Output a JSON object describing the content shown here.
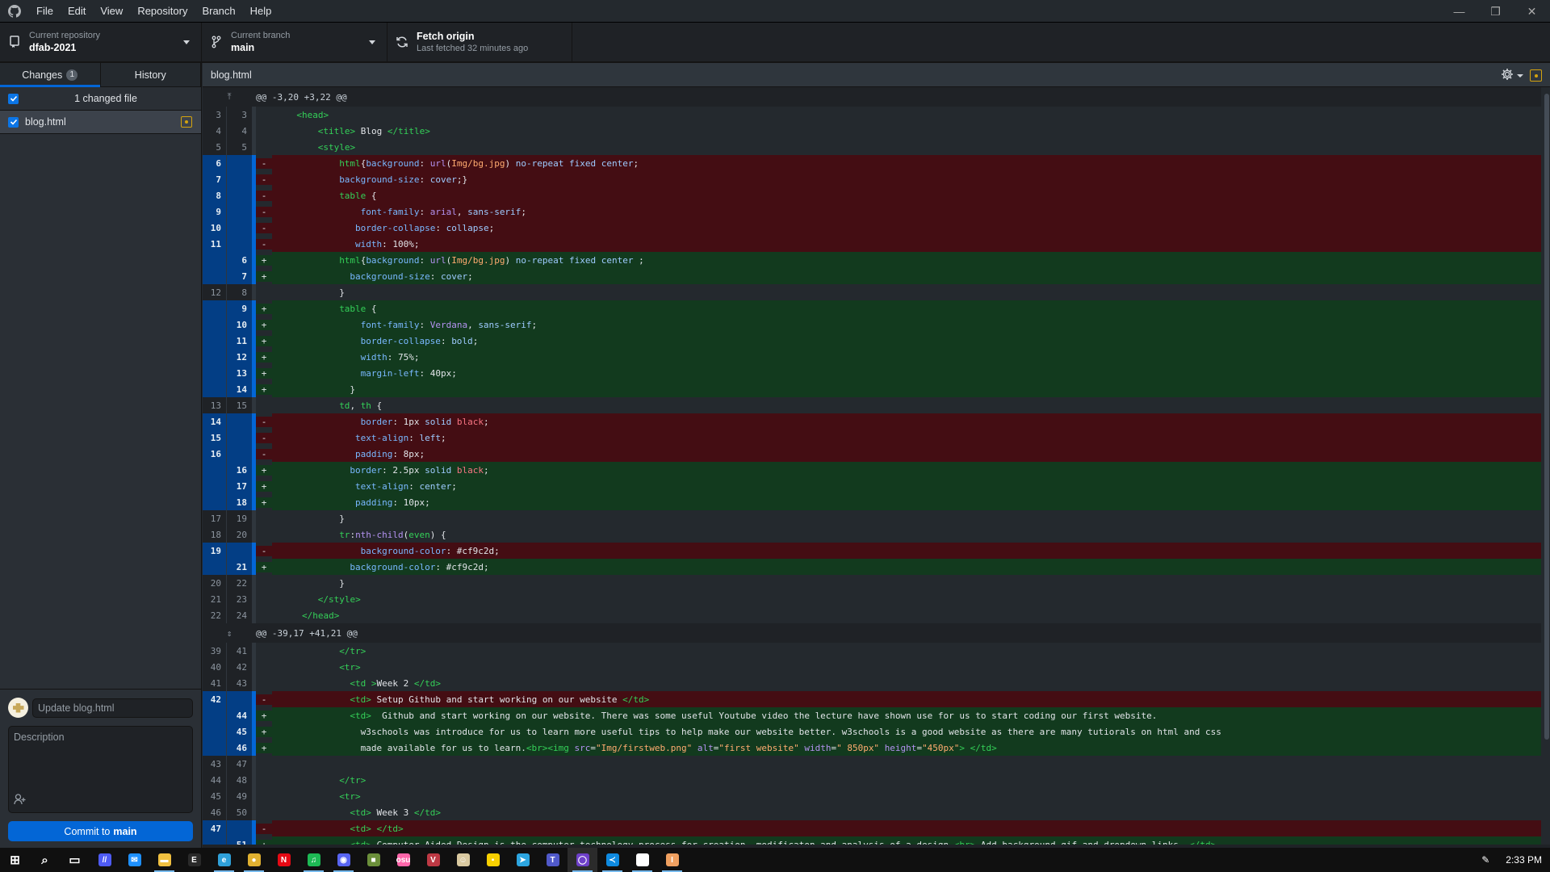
{
  "app": {
    "menu": [
      "File",
      "Edit",
      "View",
      "Repository",
      "Branch",
      "Help"
    ],
    "window_controls": [
      "minimize",
      "restore",
      "close"
    ]
  },
  "toolbar": {
    "repository": {
      "label": "Current repository",
      "value": "dfab-2021"
    },
    "branch": {
      "label": "Current branch",
      "value": "main"
    },
    "fetch": {
      "label": "Fetch origin",
      "value": "Last fetched 32 minutes ago"
    }
  },
  "sidebar": {
    "tabs": [
      {
        "label": "Changes",
        "badge": "1",
        "active": true
      },
      {
        "label": "History",
        "active": false
      }
    ],
    "changed_header": "1 changed file",
    "files": [
      {
        "name": "blog.html",
        "checked": true,
        "status": "modified"
      }
    ],
    "commit": {
      "summary_placeholder": "Update blog.html",
      "description_placeholder": "Description",
      "button_prefix": "Commit to",
      "button_branch": "main"
    }
  },
  "diff": {
    "file_name": "blog.html",
    "rows": [
      {
        "type": "hunk",
        "text": "@@ -3,20 +3,22 @@",
        "expand": "up"
      },
      {
        "type": "ctx",
        "old": "3",
        "new": "3",
        "indent": 4,
        "tokens": [
          [
            "tag",
            "<head>"
          ]
        ]
      },
      {
        "type": "ctx",
        "old": "4",
        "new": "4",
        "indent": 8,
        "tokens": [
          [
            "tag",
            "<title>"
          ],
          [
            "txt",
            " Blog "
          ],
          [
            "tag",
            "</title>"
          ]
        ]
      },
      {
        "type": "ctx",
        "old": "5",
        "new": "5",
        "indent": 8,
        "tokens": [
          [
            "tag",
            "<style>"
          ]
        ]
      },
      {
        "type": "del",
        "old": "6",
        "new": "",
        "indent": 12,
        "tokens": [
          [
            "sel",
            "html"
          ],
          [
            "txt",
            "{"
          ],
          [
            "prop",
            "background"
          ],
          [
            "txt",
            ": "
          ],
          [
            "fn",
            "url"
          ],
          [
            "txt",
            "("
          ],
          [
            "str",
            "Img/bg.jpg"
          ],
          [
            "txt",
            ") "
          ],
          [
            "val",
            "no-repeat fixed center"
          ],
          [
            "txt",
            ";"
          ]
        ]
      },
      {
        "type": "del",
        "old": "7",
        "new": "",
        "indent": 12,
        "tokens": [
          [
            "prop",
            "background-size"
          ],
          [
            "txt",
            ": "
          ],
          [
            "val",
            "cover"
          ],
          [
            "txt",
            ";}"
          ]
        ]
      },
      {
        "type": "del",
        "old": "8",
        "new": "",
        "indent": 12,
        "tokens": [
          [
            "sel",
            "table"
          ],
          [
            "txt",
            " {"
          ]
        ]
      },
      {
        "type": "del",
        "old": "9",
        "new": "",
        "indent": 16,
        "tokens": [
          [
            "prop",
            "font-family"
          ],
          [
            "txt",
            ": "
          ],
          [
            "fn",
            "arial"
          ],
          [
            "txt",
            ", "
          ],
          [
            "val",
            "sans-serif"
          ],
          [
            "txt",
            ";"
          ]
        ]
      },
      {
        "type": "del",
        "old": "10",
        "new": "",
        "indent": 15,
        "tokens": [
          [
            "prop",
            "border-collapse"
          ],
          [
            "txt",
            ": "
          ],
          [
            "val",
            "collapse"
          ],
          [
            "txt",
            ";"
          ]
        ]
      },
      {
        "type": "del",
        "old": "11",
        "new": "",
        "indent": 15,
        "tokens": [
          [
            "prop",
            "width"
          ],
          [
            "txt",
            ": 100%;"
          ]
        ]
      },
      {
        "type": "add",
        "old": "",
        "new": "6",
        "indent": 12,
        "tokens": [
          [
            "sel",
            "html"
          ],
          [
            "txt",
            "{"
          ],
          [
            "prop",
            "background"
          ],
          [
            "txt",
            ": "
          ],
          [
            "fn",
            "url"
          ],
          [
            "txt",
            "("
          ],
          [
            "str",
            "Img/bg.jpg"
          ],
          [
            "txt",
            ") "
          ],
          [
            "val",
            "no-repeat fixed center"
          ],
          [
            "txt",
            " ;"
          ]
        ]
      },
      {
        "type": "add",
        "old": "",
        "new": "7",
        "indent": 14,
        "tokens": [
          [
            "prop",
            "background-size"
          ],
          [
            "txt",
            ": "
          ],
          [
            "val",
            "cover"
          ],
          [
            "txt",
            ";"
          ]
        ]
      },
      {
        "type": "ctx",
        "old": "12",
        "new": "8",
        "indent": 12,
        "tokens": [
          [
            "txt",
            "}"
          ]
        ]
      },
      {
        "type": "add",
        "old": "",
        "new": "9",
        "indent": 12,
        "tokens": [
          [
            "sel",
            "table"
          ],
          [
            "txt",
            " {"
          ]
        ]
      },
      {
        "type": "add",
        "old": "",
        "new": "10",
        "indent": 16,
        "tokens": [
          [
            "prop",
            "font-family"
          ],
          [
            "txt",
            ": "
          ],
          [
            "fn",
            "Verdana"
          ],
          [
            "txt",
            ", "
          ],
          [
            "val",
            "sans-serif"
          ],
          [
            "txt",
            ";"
          ]
        ]
      },
      {
        "type": "add",
        "old": "",
        "new": "11",
        "indent": 16,
        "tokens": [
          [
            "prop",
            "border-collapse"
          ],
          [
            "txt",
            ": "
          ],
          [
            "val",
            "bold"
          ],
          [
            "txt",
            ";"
          ]
        ]
      },
      {
        "type": "add",
        "old": "",
        "new": "12",
        "indent": 16,
        "tokens": [
          [
            "prop",
            "width"
          ],
          [
            "txt",
            ": 75%;"
          ]
        ]
      },
      {
        "type": "add",
        "old": "",
        "new": "13",
        "indent": 16,
        "tokens": [
          [
            "prop",
            "margin-left"
          ],
          [
            "txt",
            ": 40px;"
          ]
        ]
      },
      {
        "type": "add",
        "old": "",
        "new": "14",
        "indent": 14,
        "tokens": [
          [
            "txt",
            "}"
          ]
        ]
      },
      {
        "type": "ctx",
        "old": "13",
        "new": "15",
        "indent": 12,
        "tokens": [
          [
            "sel",
            "td"
          ],
          [
            "txt",
            ", "
          ],
          [
            "sel",
            "th"
          ],
          [
            "txt",
            " {"
          ]
        ]
      },
      {
        "type": "del",
        "old": "14",
        "new": "",
        "indent": 16,
        "tokens": [
          [
            "prop",
            "border"
          ],
          [
            "txt",
            ": 1px "
          ],
          [
            "val",
            "solid"
          ],
          [
            "txt",
            " "
          ],
          [
            "red",
            "black"
          ],
          [
            "txt",
            ";"
          ]
        ]
      },
      {
        "type": "del",
        "old": "15",
        "new": "",
        "indent": 15,
        "tokens": [
          [
            "prop",
            "text-align"
          ],
          [
            "txt",
            ": "
          ],
          [
            "val",
            "left"
          ],
          [
            "txt",
            ";"
          ]
        ]
      },
      {
        "type": "del",
        "old": "16",
        "new": "",
        "indent": 15,
        "tokens": [
          [
            "prop",
            "padding"
          ],
          [
            "txt",
            ": 8px;"
          ]
        ]
      },
      {
        "type": "add",
        "old": "",
        "new": "16",
        "indent": 14,
        "tokens": [
          [
            "prop",
            "border"
          ],
          [
            "txt",
            ": 2.5px "
          ],
          [
            "val",
            "solid"
          ],
          [
            "txt",
            " "
          ],
          [
            "red",
            "black"
          ],
          [
            "txt",
            ";"
          ]
        ]
      },
      {
        "type": "add",
        "old": "",
        "new": "17",
        "indent": 15,
        "tokens": [
          [
            "prop",
            "text-align"
          ],
          [
            "txt",
            ": "
          ],
          [
            "val",
            "center"
          ],
          [
            "txt",
            ";"
          ]
        ]
      },
      {
        "type": "add",
        "old": "",
        "new": "18",
        "indent": 15,
        "tokens": [
          [
            "prop",
            "padding"
          ],
          [
            "txt",
            ": 10px;"
          ]
        ]
      },
      {
        "type": "ctx",
        "old": "17",
        "new": "19",
        "indent": 12,
        "tokens": [
          [
            "txt",
            "}"
          ]
        ]
      },
      {
        "type": "ctx",
        "old": "18",
        "new": "20",
        "indent": 12,
        "tokens": [
          [
            "sel",
            "tr"
          ],
          [
            "txt",
            ":"
          ],
          [
            "fn",
            "nth-child"
          ],
          [
            "txt",
            "("
          ],
          [
            "sel",
            "even"
          ],
          [
            "txt",
            ") {"
          ]
        ]
      },
      {
        "type": "del",
        "old": "19",
        "new": "",
        "indent": 16,
        "tokens": [
          [
            "prop",
            "background-color"
          ],
          [
            "txt",
            ": #cf9c2d;"
          ]
        ]
      },
      {
        "type": "add",
        "old": "",
        "new": "21",
        "indent": 14,
        "tokens": [
          [
            "prop",
            "background-color"
          ],
          [
            "txt",
            ": #cf9c2d;"
          ]
        ]
      },
      {
        "type": "ctx",
        "old": "20",
        "new": "22",
        "indent": 12,
        "tokens": [
          [
            "txt",
            "}"
          ]
        ]
      },
      {
        "type": "ctx",
        "old": "21",
        "new": "23",
        "indent": 8,
        "tokens": [
          [
            "tag",
            "</style>"
          ]
        ]
      },
      {
        "type": "ctx",
        "old": "22",
        "new": "24",
        "indent": 5,
        "tokens": [
          [
            "tag",
            "</head>"
          ]
        ]
      },
      {
        "type": "hunk",
        "text": "@@ -39,17 +41,21 @@",
        "expand": "both"
      },
      {
        "type": "ctx",
        "old": "39",
        "new": "41",
        "indent": 12,
        "tokens": [
          [
            "tag",
            "</tr>"
          ]
        ]
      },
      {
        "type": "ctx",
        "old": "40",
        "new": "42",
        "indent": 12,
        "tokens": [
          [
            "tag",
            "<tr>"
          ]
        ]
      },
      {
        "type": "ctx",
        "old": "41",
        "new": "43",
        "indent": 14,
        "tokens": [
          [
            "tag",
            "<td >"
          ],
          [
            "txt",
            "Week 2 "
          ],
          [
            "tag",
            "</td>"
          ]
        ]
      },
      {
        "type": "del",
        "old": "42",
        "new": "",
        "indent": 14,
        "tokens": [
          [
            "tag",
            "<td>"
          ],
          [
            "txt",
            " Setup Github and start working on our website "
          ],
          [
            "tag",
            "</td>"
          ]
        ]
      },
      {
        "type": "add",
        "old": "",
        "new": "44",
        "indent": 14,
        "tokens": [
          [
            "tag",
            "<td>"
          ],
          [
            "txt",
            "  Github and start working on our website. There was some useful Youtube video the lecture have shown use for us to start coding our first website."
          ]
        ]
      },
      {
        "type": "add",
        "old": "",
        "new": "45",
        "indent": 16,
        "tokens": [
          [
            "txt",
            "w3schools was introduce for us to learn more useful tips to help make our website better. w3schools is a good website as there are many tutiorals on html and css"
          ]
        ]
      },
      {
        "type": "add",
        "old": "",
        "new": "46",
        "indent": 16,
        "tokens": [
          [
            "txt",
            "made available for us to learn."
          ],
          [
            "tag",
            "<br><img "
          ],
          [
            "attr",
            "src"
          ],
          [
            "txt",
            "="
          ],
          [
            "str",
            "\"Img/firstweb.png\""
          ],
          [
            "txt",
            " "
          ],
          [
            "attr",
            "alt"
          ],
          [
            "txt",
            "="
          ],
          [
            "str",
            "\"first website\""
          ],
          [
            "txt",
            " "
          ],
          [
            "attr",
            "width"
          ],
          [
            "txt",
            "="
          ],
          [
            "str",
            "\" 850px\""
          ],
          [
            "txt",
            " "
          ],
          [
            "attr",
            "height"
          ],
          [
            "txt",
            "="
          ],
          [
            "str",
            "\"450px\""
          ],
          [
            "tag",
            ">"
          ],
          [
            "txt",
            " "
          ],
          [
            "tag",
            "</td>"
          ]
        ]
      },
      {
        "type": "ctx",
        "old": "43",
        "new": "47",
        "indent": 0,
        "tokens": []
      },
      {
        "type": "ctx",
        "old": "44",
        "new": "48",
        "indent": 12,
        "tokens": [
          [
            "tag",
            "</tr>"
          ]
        ]
      },
      {
        "type": "ctx",
        "old": "45",
        "new": "49",
        "indent": 12,
        "tokens": [
          [
            "tag",
            "<tr>"
          ]
        ]
      },
      {
        "type": "ctx",
        "old": "46",
        "new": "50",
        "indent": 14,
        "tokens": [
          [
            "tag",
            "<td>"
          ],
          [
            "txt",
            " Week 3 "
          ],
          [
            "tag",
            "</td>"
          ]
        ]
      },
      {
        "type": "del",
        "old": "47",
        "new": "",
        "indent": 14,
        "tokens": [
          [
            "tag",
            "<td>"
          ],
          [
            "txt",
            " "
          ],
          [
            "tag",
            "</td>"
          ]
        ]
      },
      {
        "type": "add",
        "old": "",
        "new": "51",
        "indent": 14,
        "tokens": [
          [
            "tag",
            "<td>"
          ],
          [
            "txt",
            " Computer Aided Design is the computer technology process for creation, modificaton and analysis of a design "
          ],
          [
            "tag",
            "<br>"
          ],
          [
            "txt",
            " Add background gif and dropdown links. "
          ],
          [
            "tag",
            "</td>"
          ]
        ]
      }
    ]
  },
  "taskbar": {
    "apps": [
      {
        "name": "start",
        "glyph": "⊞",
        "color": "#ffffff"
      },
      {
        "name": "search",
        "glyph": "⌕",
        "color": "#ffffff"
      },
      {
        "name": "task-view",
        "glyph": "▭",
        "color": "#ffffff"
      },
      {
        "name": "app-1",
        "glyph": "//",
        "color": "#4e5bf5"
      },
      {
        "name": "mail",
        "glyph": "✉",
        "color": "#1e90ff",
        "running": false
      },
      {
        "name": "file-explorer",
        "glyph": "▬",
        "color": "#f0c040",
        "running": true
      },
      {
        "name": "epic-games",
        "glyph": "E",
        "color": "#2a2a2a"
      },
      {
        "name": "edge",
        "glyph": "e",
        "color": "#2fa0d8",
        "running": true
      },
      {
        "name": "chrome",
        "glyph": "●",
        "color": "#e0b030",
        "running": true
      },
      {
        "name": "netflix",
        "glyph": "N",
        "color": "#e50914"
      },
      {
        "name": "spotify",
        "glyph": "♫",
        "color": "#1db954",
        "running": true
      },
      {
        "name": "discord",
        "glyph": "◉",
        "color": "#5865f2",
        "running": true
      },
      {
        "name": "minecraft",
        "glyph": "■",
        "color": "#6b8f3a"
      },
      {
        "name": "osu",
        "glyph": "osu",
        "color": "#ff66aa"
      },
      {
        "name": "valorant",
        "glyph": "V",
        "color": "#bd3944"
      },
      {
        "name": "anime-app",
        "glyph": "☺",
        "color": "#d9c9a0"
      },
      {
        "name": "sticky-notes",
        "glyph": "▪",
        "color": "#f8d000"
      },
      {
        "name": "telegram",
        "glyph": "➤",
        "color": "#2ca5e0"
      },
      {
        "name": "teams",
        "glyph": "T",
        "color": "#5059c9"
      },
      {
        "name": "github-desktop",
        "glyph": "◯",
        "color": "#6e40c9",
        "running": true,
        "active": true
      },
      {
        "name": "vscode",
        "glyph": "≺",
        "color": "#0e8ae0",
        "running": true
      },
      {
        "name": "obs",
        "glyph": "◎",
        "color": "#ffffff",
        "running": true
      },
      {
        "name": "app-last",
        "glyph": "I",
        "color": "#f0a060",
        "running": true
      }
    ],
    "time": "2:33 PM"
  }
}
